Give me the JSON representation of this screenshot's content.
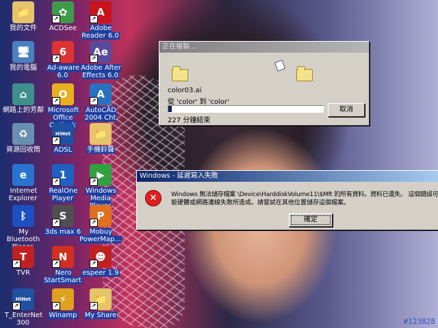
{
  "desktop": {
    "icons": [
      {
        "label": "我的文件",
        "icon": "folder-icon",
        "glyph": "📁",
        "color": "#e6c46a",
        "shortcut": false,
        "selected": false
      },
      {
        "label": "ACDSee",
        "icon": "acdsee-icon",
        "glyph": "✿",
        "color": "#3f9b4a",
        "shortcut": true,
        "selected": false
      },
      {
        "label": "Adobe Reader 6.0",
        "icon": "adobe-reader-icon",
        "glyph": "A",
        "color": "#c8141c",
        "shortcut": true,
        "selected": true
      },
      {
        "label": "我的電腦",
        "icon": "computer-icon",
        "glyph": "🖥",
        "color": "#4a7fc0",
        "shortcut": false,
        "selected": false
      },
      {
        "label": "Ad-aware 6.0",
        "icon": "adaware-icon",
        "glyph": "6",
        "color": "#d33",
        "shortcut": true,
        "selected": true
      },
      {
        "label": "Adobe After Effects 6.0",
        "icon": "after-effects-icon",
        "glyph": "Ae",
        "color": "#5a4a9a",
        "shortcut": true,
        "selected": true
      },
      {
        "label": "網路上的芳鄰",
        "icon": "network-icon",
        "glyph": "⌂",
        "color": "#3f8f8a",
        "shortcut": false,
        "selected": false
      },
      {
        "label": "Microsoft Office Outlook",
        "icon": "outlook-icon",
        "glyph": "O",
        "color": "#e8b020",
        "shortcut": true,
        "selected": true
      },
      {
        "label": "AutoCAD 2004 Cht",
        "icon": "autocad-icon",
        "glyph": "A",
        "color": "#2a70c0",
        "shortcut": true,
        "selected": true
      },
      {
        "label": "資源回收筒",
        "icon": "recycle-bin-icon",
        "glyph": "♻",
        "color": "#6a8fb0",
        "shortcut": false,
        "selected": false
      },
      {
        "label": "ADSL",
        "icon": "adsl-icon",
        "glyph": "HiNet",
        "color": "#2050a0",
        "shortcut": true,
        "selected": true
      },
      {
        "label": "手機鈴聲",
        "icon": "folder-icon",
        "glyph": "📁",
        "color": "#e6c46a",
        "shortcut": false,
        "selected": true
      },
      {
        "label": "Internet Explorer",
        "icon": "internet-explorer-icon",
        "glyph": "e",
        "color": "#2a74d0",
        "shortcut": false,
        "selected": false
      },
      {
        "label": "RealOne Player",
        "icon": "realone-icon",
        "glyph": "1",
        "color": "#2060c0",
        "shortcut": true,
        "selected": true
      },
      {
        "label": "Windows Media Player",
        "icon": "media-player-icon",
        "glyph": "▶",
        "color": "#30a040",
        "shortcut": true,
        "selected": true
      },
      {
        "label": "My Bluetooth Places",
        "icon": "bluetooth-icon",
        "glyph": "ᛒ",
        "color": "#1d4fc0",
        "shortcut": false,
        "selected": false
      },
      {
        "label": "3ds max 6",
        "icon": "3dsmax-icon",
        "glyph": "S",
        "color": "#505050",
        "shortcut": true,
        "selected": true
      },
      {
        "label": "Mobuy PowerMap...",
        "icon": "mobuy-icon",
        "glyph": "P",
        "color": "#e07020",
        "shortcut": true,
        "selected": true
      },
      {
        "label": "TVR",
        "icon": "tvr-icon",
        "glyph": "T",
        "color": "#c02020",
        "shortcut": true,
        "selected": false
      },
      {
        "label": "Nero StartSmart",
        "icon": "nero-icon",
        "glyph": "N",
        "color": "#d03020",
        "shortcut": true,
        "selected": true
      },
      {
        "label": "espeer 1.9",
        "icon": "espeer-icon",
        "glyph": "☻",
        "color": "#c02020",
        "shortcut": true,
        "selected": true
      },
      {
        "label": "T_EnterNet 300",
        "icon": "enternet-icon",
        "glyph": "HiNet",
        "color": "#2050a0",
        "shortcut": true,
        "selected": false
      },
      {
        "label": "Winamp",
        "icon": "winamp-icon",
        "glyph": "⚡",
        "color": "#e0a020",
        "shortcut": true,
        "selected": true
      },
      {
        "label": "My Share",
        "icon": "folder-icon",
        "glyph": "📁",
        "color": "#e6c46a",
        "shortcut": true,
        "selected": true
      }
    ]
  },
  "copy_dialog": {
    "title": "正在複製...",
    "filename": "color03.ai",
    "from_to": "從 'color' 到 'color'",
    "progress": 0.02,
    "remaining": "227 分鐘結束",
    "cancel_label": "取消"
  },
  "error_dialog": {
    "title": "Windows - 延遲寫入失敗",
    "message_line1": "Windows 無法儲存檔案 \\Device\\HarddiskVolume11\\$Mft 的所有資料。資料已遺失。 這個錯誤可",
    "message_line2": "能硬體或網路連線失敗所造成。請嘗試在其他位置儲存這個檔案。",
    "ok_label": "確定"
  },
  "watermark": "#123828"
}
